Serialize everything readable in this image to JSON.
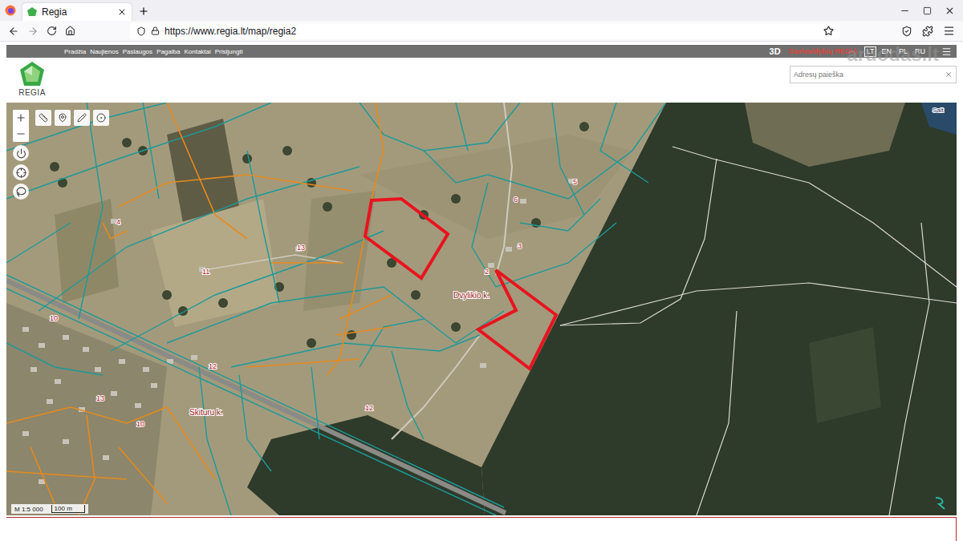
{
  "browser": {
    "tab": {
      "title": "Regia",
      "selected": true
    },
    "url": "https://www.regia.lt/map/regia2"
  },
  "header": {
    "logo": "REGIA",
    "nav": [
      "Pradžia",
      "Naujienos",
      "Paslaugos",
      "Pagalba",
      "Kontaktai",
      "Prisijungti"
    ],
    "mode": "3D",
    "product": "Savivaldybių REGIA",
    "languages": [
      {
        "label": "LT",
        "selected": true
      },
      {
        "label": "EN",
        "selected": false
      },
      {
        "label": "PL",
        "selected": false
      },
      {
        "label": "RU",
        "selected": false
      }
    ]
  },
  "search": {
    "placeholder": "Adresų paieška"
  },
  "watermark": "aruodas.lt",
  "map": {
    "villages": [
      "Dvylikio k.",
      "Skituru k."
    ],
    "house_numbers": [
      "13",
      "11",
      "2",
      "3",
      "5",
      "6",
      "4",
      "10",
      "12",
      "13",
      "10",
      "12"
    ],
    "edge_label": "Salt",
    "scale": "M 1:5 000",
    "scale_bar": "100 m"
  }
}
